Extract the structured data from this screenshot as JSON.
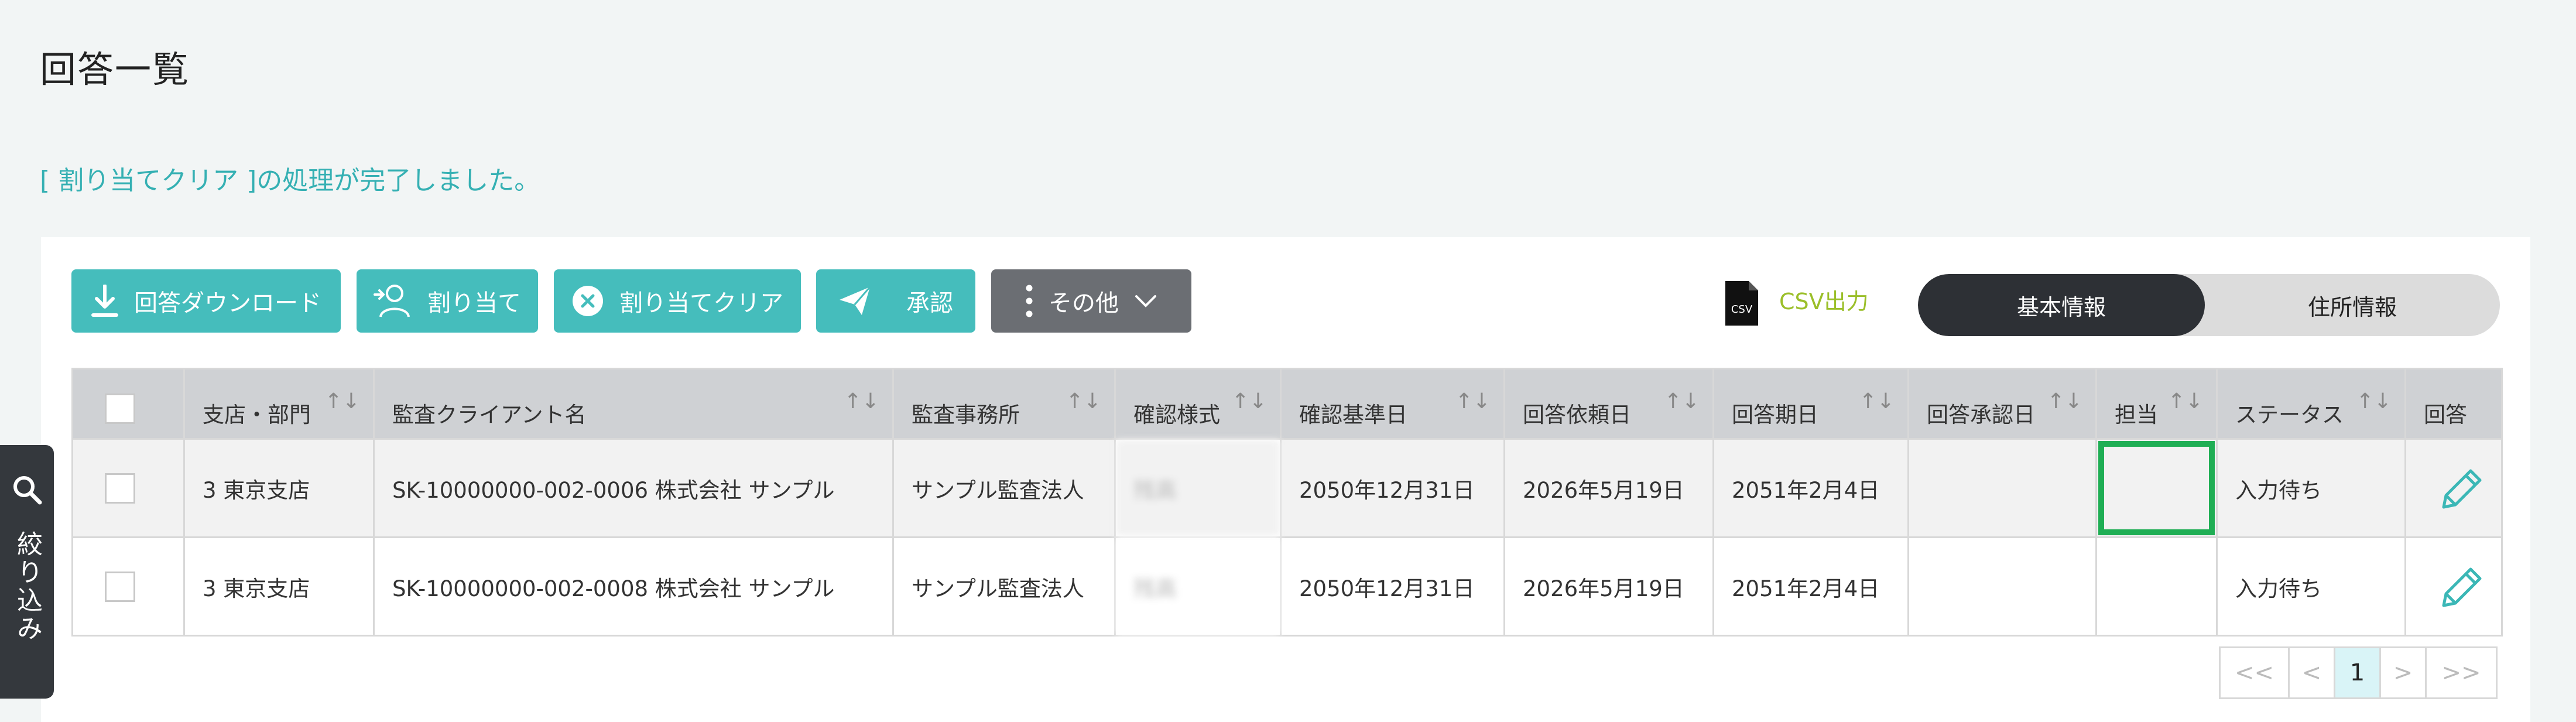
{
  "page_title": "回答一覧",
  "flash_message": "[ 割り当てクリア ]の処理が完了しました。",
  "toolbar": {
    "download_label": "回答ダウンロード",
    "assign_label": "割り当て",
    "assign_clear_label": "割り当てクリア",
    "approve_label": "承認",
    "other_label": "その他",
    "csv_icon_text": "CSV",
    "csv_label": "CSV出力"
  },
  "view_toggle": {
    "basic": "基本情報",
    "address": "住所情報"
  },
  "table": {
    "headers": {
      "branch": "支店・部門",
      "client": "監査クライアント名",
      "office": "監査事務所",
      "form": "確認様式",
      "base_date": "確認基準日",
      "request_date": "回答依頼日",
      "due_date": "回答期日",
      "approval_date": "回答承認日",
      "assignee": "担当",
      "status": "ステータス",
      "answer": "回答"
    },
    "rows": [
      {
        "branch": "3 東京支店",
        "client": "SK-10000000-002-0006 株式会社 サンプル",
        "office": "サンプル監査法人",
        "form": "残高",
        "base_date": "2050年12月31日",
        "request_date": "2026年5月19日",
        "due_date": "2051年2月4日",
        "approval_date": "",
        "assignee": "",
        "status": "入力待ち"
      },
      {
        "branch": "3 東京支店",
        "client": "SK-10000000-002-0008 株式会社 サンプル",
        "office": "サンプル監査法人",
        "form": "残高",
        "base_date": "2050年12月31日",
        "request_date": "2026年5月19日",
        "due_date": "2051年2月4日",
        "approval_date": "",
        "assignee": "",
        "status": "入力待ち"
      }
    ]
  },
  "pagination": {
    "first": "<<",
    "prev": "<",
    "current": "1",
    "next": ">",
    "last": ">>"
  },
  "filter_label": "絞り込み",
  "colors": {
    "teal": "#45bdbc",
    "dark": "#2d3035",
    "highlight": "#1fae54",
    "csv_green": "#9bbf2a"
  }
}
